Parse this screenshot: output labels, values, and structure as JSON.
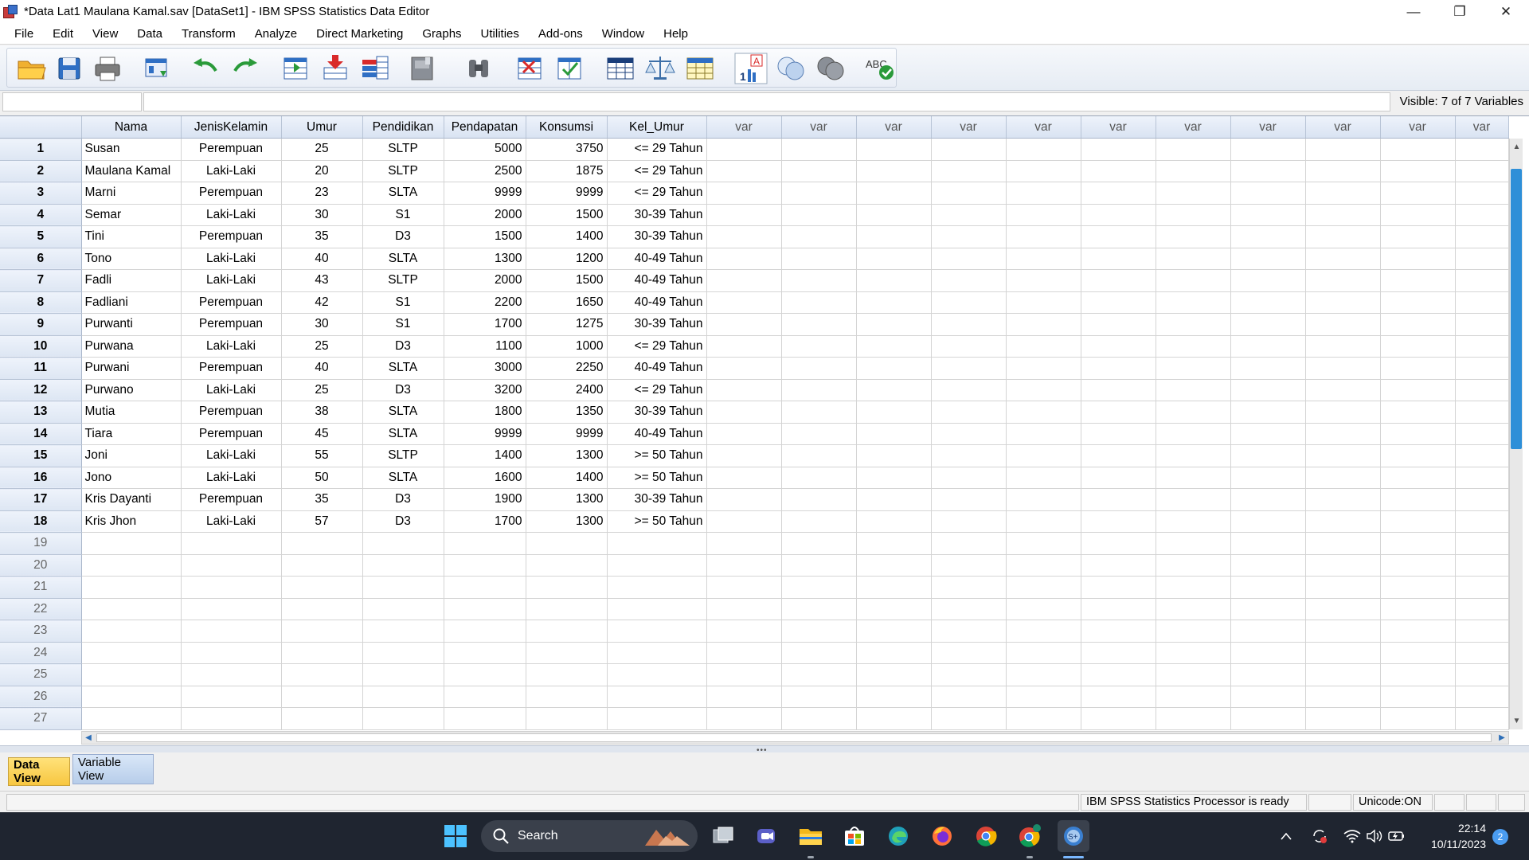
{
  "window": {
    "title": "*Data Lat1 Maulana Kamal.sav [DataSet1] - IBM SPSS Statistics Data Editor",
    "minimize": "—",
    "restore": "❐",
    "close": "✕"
  },
  "menu": [
    {
      "label": "File"
    },
    {
      "label": "Edit"
    },
    {
      "label": "View"
    },
    {
      "label": "Data"
    },
    {
      "label": "Transform"
    },
    {
      "label": "Analyze"
    },
    {
      "label": "Direct Marketing"
    },
    {
      "label": "Graphs"
    },
    {
      "label": "Utilities"
    },
    {
      "label": "Add-ons"
    },
    {
      "label": "Window"
    },
    {
      "label": "Help"
    }
  ],
  "toolbar": {
    "icons": [
      "open-folder-icon",
      "save-icon",
      "print-icon",
      "recall-dialog-icon",
      "undo-icon",
      "redo-icon",
      "goto-case-icon",
      "goto-variable-icon",
      "variables-icon",
      "run-descriptive-icon",
      "find-icon",
      "insert-cases-icon",
      "insert-variable-icon",
      "split-file-icon",
      "weight-cases-icon",
      "select-cases-icon",
      "value-labels-icon",
      "use-variable-sets-icon",
      "show-all-variables-icon",
      "spell-check-icon"
    ]
  },
  "info": {
    "visible": "Visible: 7 of 7 Variables"
  },
  "grid": {
    "columns": [
      "Nama",
      "JenisKelamin",
      "Umur",
      "Pendidikan",
      "Pendapatan",
      "Konsumsi",
      "Kel_Umur"
    ],
    "var_label": "var",
    "rows": [
      [
        "1",
        "Susan",
        "Perempuan",
        "25",
        "SLTP",
        "5000",
        "3750",
        "<= 29 Tahun"
      ],
      [
        "2",
        "Maulana Kamal",
        "Laki-Laki",
        "20",
        "SLTP",
        "2500",
        "1875",
        "<= 29 Tahun"
      ],
      [
        "3",
        "Marni",
        "Perempuan",
        "23",
        "SLTA",
        "9999",
        "9999",
        "<= 29 Tahun"
      ],
      [
        "4",
        "Semar",
        "Laki-Laki",
        "30",
        "S1",
        "2000",
        "1500",
        "30-39 Tahun"
      ],
      [
        "5",
        "Tini",
        "Perempuan",
        "35",
        "D3",
        "1500",
        "1400",
        "30-39 Tahun"
      ],
      [
        "6",
        "Tono",
        "Laki-Laki",
        "40",
        "SLTA",
        "1300",
        "1200",
        "40-49 Tahun"
      ],
      [
        "7",
        "Fadli",
        "Laki-Laki",
        "43",
        "SLTP",
        "2000",
        "1500",
        "40-49 Tahun"
      ],
      [
        "8",
        "Fadliani",
        "Perempuan",
        "42",
        "S1",
        "2200",
        "1650",
        "40-49 Tahun"
      ],
      [
        "9",
        "Purwanti",
        "Perempuan",
        "30",
        "S1",
        "1700",
        "1275",
        "30-39 Tahun"
      ],
      [
        "10",
        "Purwana",
        "Laki-Laki",
        "25",
        "D3",
        "1100",
        "1000",
        "<= 29 Tahun"
      ],
      [
        "11",
        "Purwani",
        "Perempuan",
        "40",
        "SLTA",
        "3000",
        "2250",
        "40-49 Tahun"
      ],
      [
        "12",
        "Purwano",
        "Laki-Laki",
        "25",
        "D3",
        "3200",
        "2400",
        "<= 29 Tahun"
      ],
      [
        "13",
        "Mutia",
        "Perempuan",
        "38",
        "SLTA",
        "1800",
        "1350",
        "30-39 Tahun"
      ],
      [
        "14",
        "Tiara",
        "Perempuan",
        "45",
        "SLTA",
        "9999",
        "9999",
        "40-49 Tahun"
      ],
      [
        "15",
        "Joni",
        "Laki-Laki",
        "55",
        "SLTP",
        "1400",
        "1300",
        ">= 50 Tahun"
      ],
      [
        "16",
        "Jono",
        "Laki-Laki",
        "50",
        "SLTA",
        "1600",
        "1400",
        ">= 50 Tahun"
      ],
      [
        "17",
        "Kris Dayanti",
        "Perempuan",
        "35",
        "D3",
        "1900",
        "1300",
        "30-39 Tahun"
      ],
      [
        "18",
        "Kris Jhon",
        "Laki-Laki",
        "57",
        "D3",
        "1700",
        "1300",
        ">= 50 Tahun"
      ]
    ],
    "empty_rows": [
      "19",
      "20",
      "21",
      "22",
      "23",
      "24",
      "25",
      "26",
      "27"
    ]
  },
  "tabs": {
    "data_view": "Data View",
    "variable_view": "Variable View"
  },
  "status": {
    "processor": "IBM SPSS Statistics Processor is ready",
    "unicode": "Unicode:ON"
  },
  "taskbar": {
    "search_label": "Search",
    "time": "22:14",
    "date": "10/11/2023",
    "notifications": "2"
  },
  "colors": {
    "accent_blue": "#2e8fd8",
    "active_tab": "#f7c640",
    "header_bg": "#d9e3f2"
  }
}
